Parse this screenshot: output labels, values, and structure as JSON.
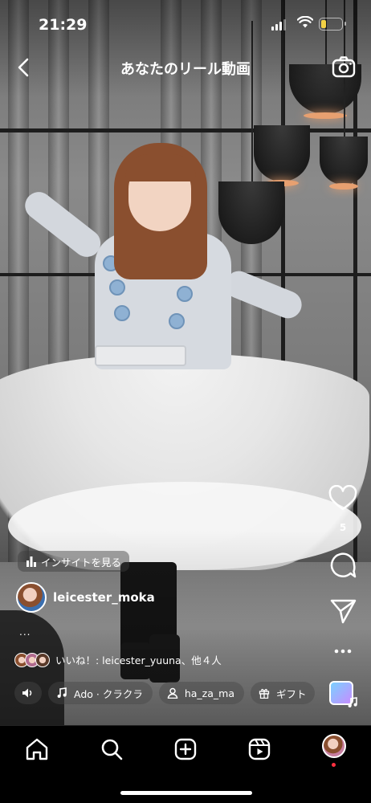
{
  "status_bar": {
    "time": "21:29"
  },
  "header": {
    "title": "あなたのリール動画"
  },
  "rail": {
    "like_count": "5"
  },
  "insight_button": {
    "label": "インサイトを見る"
  },
  "author": {
    "username": "leicester_moka",
    "caption_more": "..."
  },
  "likes": {
    "text": "いいね！: leicester_yuuna、他４人"
  },
  "chips": {
    "audio": "Ado · クラクラ",
    "tagged_user": "ha_za_ma",
    "gift": "ギフト"
  },
  "colors": {
    "like_accent": "#ff3040",
    "battery": "#f2d144"
  },
  "icons": [
    "back-chevron-icon",
    "camera-icon",
    "heart-icon",
    "comment-icon",
    "send-icon",
    "more-icon",
    "volume-icon",
    "music-note-icon",
    "person-icon",
    "gift-icon",
    "home-icon",
    "search-icon",
    "create-icon",
    "reels-icon"
  ]
}
